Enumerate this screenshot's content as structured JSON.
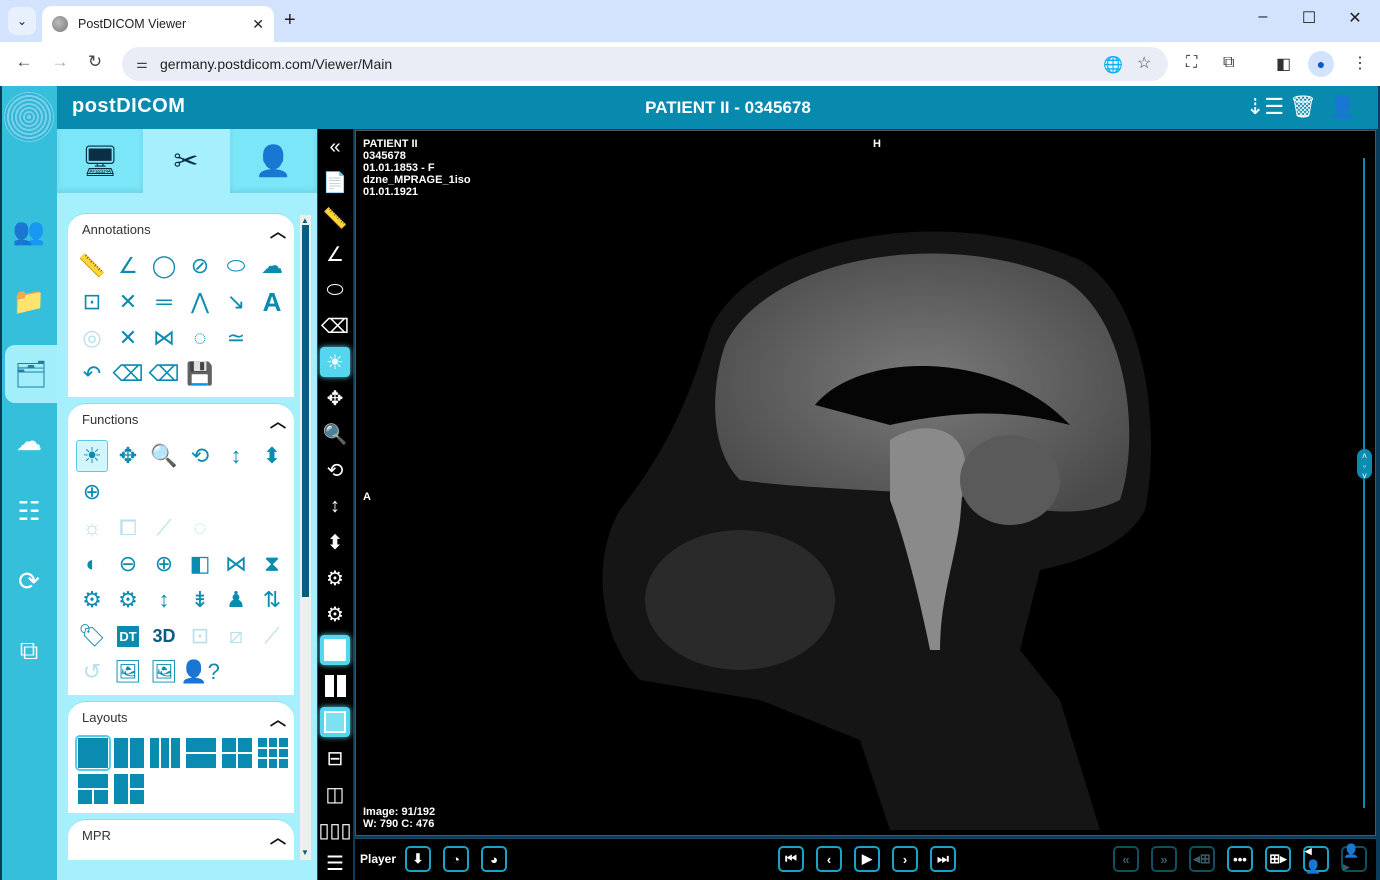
{
  "browser": {
    "tab_title": "PostDICOM Viewer",
    "url": "germany.postdicom.com/Viewer/Main",
    "window_controls": [
      "minimize",
      "maximize",
      "close"
    ]
  },
  "app": {
    "brand": "postDICOM",
    "patient_header": "PATIENT II - 0345678",
    "header_icons": [
      "sort-list-icon",
      "recycle-bin-icon",
      "user-icon"
    ]
  },
  "leftnav": {
    "items": [
      {
        "name": "patients",
        "icon": "users-icon"
      },
      {
        "name": "folders",
        "icon": "folder-icon"
      },
      {
        "name": "viewer",
        "icon": "xray-images-icon",
        "active": true
      },
      {
        "name": "upload",
        "icon": "cloud-upload-icon"
      },
      {
        "name": "search",
        "icon": "list-search-icon"
      },
      {
        "name": "sync",
        "icon": "sync-icon"
      },
      {
        "name": "remote",
        "icon": "monitor-transfer-icon"
      }
    ]
  },
  "sidepanel": {
    "tabs": [
      {
        "name": "study-info",
        "icon": "monitor-xray-icon"
      },
      {
        "name": "tools",
        "icon": "tools-icon",
        "active": true
      },
      {
        "name": "patient-info",
        "icon": "user-info-icon"
      }
    ],
    "sections": {
      "annotations": {
        "title": "Annotations",
        "tools": [
          "ruler",
          "angle",
          "circle",
          "hatched-circle",
          "ellipse",
          "freehand",
          "rectangle-roi",
          "cross",
          "parallel-lines",
          "polyline",
          "arrow",
          "text",
          "probe",
          "cobb-angle",
          "spline",
          "closed-spline",
          "wave",
          "undo",
          "erase",
          "erase-all",
          "save-annotations"
        ]
      },
      "functions": {
        "title": "Functions",
        "tools": [
          "window-level",
          "pan",
          "zoom",
          "rotate",
          "scroll",
          "stack",
          "reset-center",
          "auto-wl",
          "crop",
          "bone",
          "region",
          "invert",
          "zoom-out",
          "zoom-in",
          "flip-horizontal",
          "mirror",
          "flip-vertical",
          "rotate-left",
          "rotate-right",
          "stretch-vertical",
          "compress",
          "full-body",
          "swap",
          "tag",
          "DT",
          "3D",
          "fit",
          "diagonal",
          "bone-2",
          "reset",
          "export-image",
          "save-image",
          "help-user"
        ]
      },
      "layouts": {
        "title": "Layouts",
        "options": [
          "1x1",
          "1x2",
          "1x3",
          "2x1",
          "2x2",
          "3x3",
          "top-1-bottom-2",
          "left-1-right-2"
        ]
      },
      "mpr": {
        "title": "MPR"
      }
    }
  },
  "vtoolbar": [
    "collapse",
    "report",
    "ruler",
    "angle",
    "ellipse",
    "eraser",
    "window-level",
    "pan",
    "zoom",
    "rotate",
    "scroll",
    "stack",
    "rotate-left",
    "rotate-light",
    "layout-1x1",
    "layout-1x2",
    "layout-active",
    "layout-2-top",
    "layout-side",
    "layout-3col",
    "layout-rows"
  ],
  "viewport": {
    "overlay_top_left": [
      "PATIENT II",
      "0345678",
      "01.01.1853 - F",
      "dzne_MPRAGE_1iso",
      "01.01.1921"
    ],
    "orientation_top": "H",
    "orientation_left": "A",
    "image_index": "Image: 91/192",
    "window_center": "W: 790 C: 476",
    "slice_position": 0.47
  },
  "player": {
    "label": "Player",
    "left_buttons": [
      "download-arrow",
      "speed-down",
      "speed-up"
    ],
    "center_buttons": [
      "first",
      "previous",
      "play",
      "next",
      "last"
    ],
    "right_buttons": [
      {
        "name": "prev-series",
        "enabled": false
      },
      {
        "name": "next-series",
        "enabled": false
      },
      {
        "name": "prev-layout",
        "enabled": false
      },
      {
        "name": "more",
        "enabled": true
      },
      {
        "name": "next-layout",
        "enabled": true
      },
      {
        "name": "prev-patient",
        "enabled": true
      },
      {
        "name": "next-patient",
        "enabled": false
      }
    ]
  }
}
